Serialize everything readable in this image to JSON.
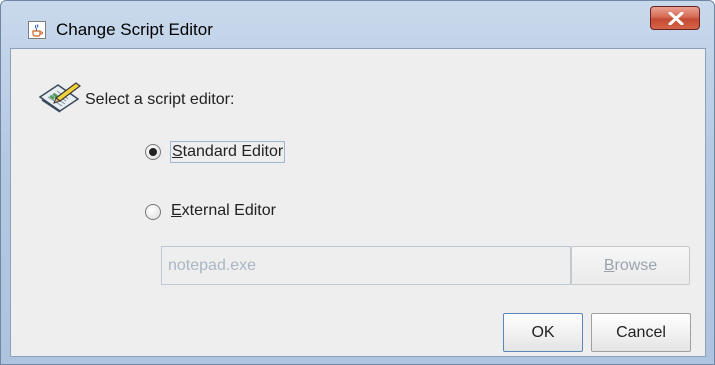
{
  "window": {
    "title": "Change Script Editor"
  },
  "header": {
    "label": "Select a script editor:"
  },
  "options": [
    {
      "prefix": "",
      "mnemonic": "S",
      "rest": "tandard Editor",
      "selected": true
    },
    {
      "prefix": "",
      "mnemonic": "E",
      "rest": "xternal Editor",
      "selected": false
    }
  ],
  "external": {
    "path_value": "notepad.exe",
    "browse": {
      "mnemonic": "B",
      "rest": "rowse"
    }
  },
  "buttons": {
    "ok": "OK",
    "cancel": "Cancel"
  },
  "icons": {
    "app": "java-cup-icon",
    "close": "close-icon",
    "header": "script-edit-icon"
  },
  "colors": {
    "close_button": "#c44a33",
    "disabled_text": "#a9b6c6",
    "client_bg": "#eeeeee"
  }
}
